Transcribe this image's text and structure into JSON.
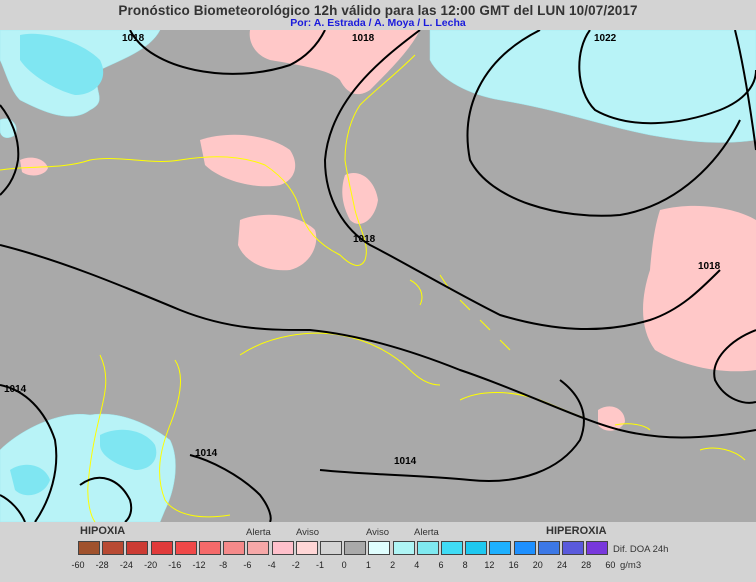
{
  "header": {
    "title": "Pronóstico Biometeorológico 12h  válido para las 12:00 GMT del LUN 10/07/2017",
    "authors": "Por: A. Estrada / A. Moya / L. Lecha"
  },
  "map": {
    "background_color": "#a9a9a9",
    "isobar_labels": [
      "1018",
      "1018",
      "1022",
      "1018",
      "1018",
      "1014",
      "1014",
      "1014"
    ]
  },
  "legend": {
    "hipoxia_label": "HIPOXIA",
    "hiperoxia_label": "HIPEROXIA",
    "alerta_left": "Alerta",
    "aviso_left": "Aviso",
    "aviso_right": "Aviso",
    "alerta_right": "Alerta",
    "units_line1": "Dif. DOA 24h",
    "units_line2": "g/m3",
    "ticks": [
      "-60",
      "-28",
      "-24",
      "-20",
      "-16",
      "-12",
      "-8",
      "-6",
      "-4",
      "-2",
      "-1",
      "0",
      "1",
      "2",
      "4",
      "6",
      "8",
      "12",
      "16",
      "20",
      "24",
      "28",
      "60"
    ],
    "colors": [
      "#a0522d",
      "#b84a33",
      "#cc3b33",
      "#e03a3a",
      "#f04848",
      "#f56a6a",
      "#f58a8a",
      "#f6a8a8",
      "#ffc0cb",
      "#ffd6d6",
      "#d3d3d3",
      "#a9a9a9",
      "#e0ffff",
      "#aff5f5",
      "#7fe9f0",
      "#40dcf5",
      "#1ec8f0",
      "#1eb0ff",
      "#1e90ff",
      "#3c78e6",
      "#5a5adc",
      "#7838dc",
      "#9a14d0"
    ]
  }
}
